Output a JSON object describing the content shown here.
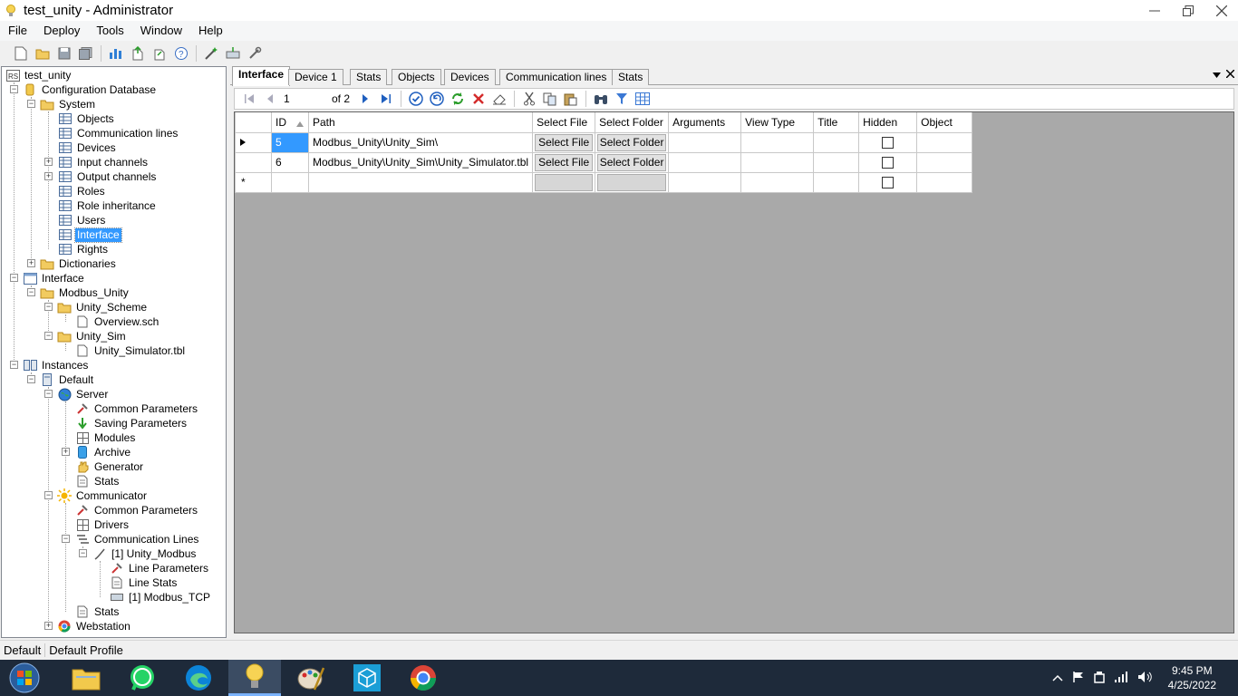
{
  "window": {
    "title": "test_unity - Administrator"
  },
  "menu": [
    "File",
    "Deploy",
    "Tools",
    "Window",
    "Help"
  ],
  "toolbar_icons": [
    "new-icon",
    "open-icon",
    "save-icon",
    "save-all-icon",
    "chart-icon",
    "upload-icon",
    "export-icon",
    "help-icon",
    "wizard-icon",
    "import-icon",
    "tools-icon"
  ],
  "tree": {
    "root": "test_unity",
    "root_badge": "RS",
    "configuration_database": "Configuration Database",
    "system": "System",
    "objects": "Objects",
    "communication_lines": "Communication lines",
    "devices": "Devices",
    "input_channels": "Input channels",
    "output_channels": "Output channels",
    "roles": "Roles",
    "role_inheritance": "Role inheritance",
    "users": "Users",
    "interface_table": "Interface",
    "rights": "Rights",
    "dictionaries": "Dictionaries",
    "interface": "Interface",
    "modbus_unity": "Modbus_Unity",
    "unity_scheme": "Unity_Scheme",
    "overview_sch": "Overview.sch",
    "unity_sim": "Unity_Sim",
    "unity_simulator_tbl": "Unity_Simulator.tbl",
    "instances": "Instances",
    "default": "Default",
    "server": "Server",
    "server_common_parameters": "Common Parameters",
    "saving_parameters": "Saving Parameters",
    "modules": "Modules",
    "archive": "Archive",
    "generator": "Generator",
    "server_stats": "Stats",
    "communicator": "Communicator",
    "comm_common_parameters": "Common Parameters",
    "drivers": "Drivers",
    "communication_lines_node": "Communication Lines",
    "unity_modbus_line": "[1] Unity_Modbus",
    "line_parameters": "Line Parameters",
    "line_stats": "Line Stats",
    "modbus_tcp": "[1] Modbus_TCP",
    "comm_stats": "Stats",
    "webstation": "Webstation"
  },
  "tabs": [
    "Interface",
    "Device 1",
    "Stats",
    "Objects",
    "Devices",
    "Communication lines",
    "Stats"
  ],
  "navigator": {
    "position": "1",
    "of": "of 2"
  },
  "grid": {
    "columns": [
      "ID",
      "Path",
      "Select File",
      "Select Folder",
      "Arguments",
      "View Type",
      "Title",
      "Hidden",
      "Object"
    ],
    "rows": [
      {
        "id": "5",
        "path": "Modbus_Unity\\Unity_Sim\\",
        "select_file": "Select File",
        "select_folder": "Select Folder",
        "arguments": "",
        "view_type": "",
        "title": "",
        "hidden": false,
        "object": ""
      },
      {
        "id": "6",
        "path": "Modbus_Unity\\Unity_Sim\\Unity_Simulator.tbl",
        "select_file": "Select File",
        "select_folder": "Select Folder",
        "arguments": "",
        "view_type": "",
        "title": "",
        "hidden": false,
        "object": ""
      }
    ],
    "new_row_marker": "*"
  },
  "status": {
    "left": "Default",
    "right": "Default Profile"
  },
  "taskbar": {
    "time": "9:45 PM",
    "date": "4/25/2022"
  },
  "colors": {
    "selection": "#3399ff",
    "taskbar": "#1e2a3a",
    "grid_background": "#a9a9a9"
  }
}
